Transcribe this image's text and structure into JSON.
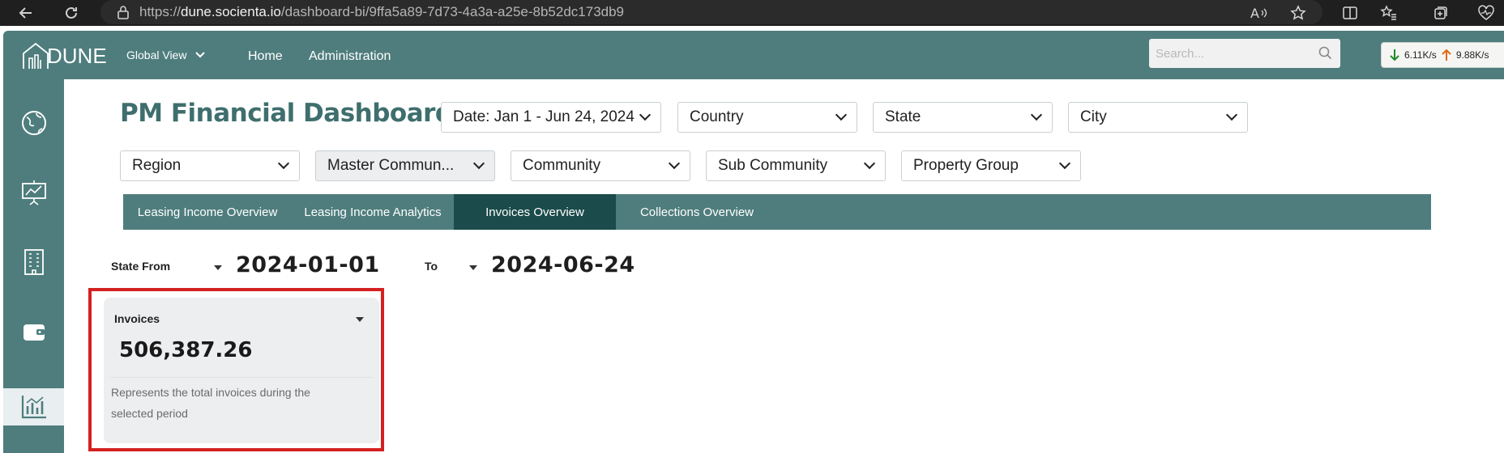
{
  "browser": {
    "url_prefix": "https://",
    "url_host": "dune.socienta.io",
    "url_path": "/dashboard-bi/9ffa5a89-7d73-4a3a-a25e-8b52dc173db9"
  },
  "header": {
    "logo_text": "DUNE",
    "global_view": "Global View",
    "nav": [
      "Home",
      "Administration"
    ],
    "search_placeholder": "Search...",
    "net_down": "6.11K/s",
    "net_up": "9.88K/s"
  },
  "sidebar": {
    "items": [
      "globe-icon",
      "presentation-chart-icon",
      "building-icon",
      "wallet-icon",
      "analytics-chart-icon"
    ],
    "active_index": 4
  },
  "dashboard": {
    "title": "PM Financial Dashboard",
    "filters_row1": [
      "Date: Jan 1 - Jun 24, 2024",
      "Country",
      "State",
      "City"
    ],
    "filters_row2": [
      "Region",
      "Master Commun...",
      "Community",
      "Sub Community",
      "Property Group"
    ],
    "tabs": [
      "Leasing Income Overview",
      "Leasing Income Analytics",
      "Invoices Overview",
      "Collections Overview"
    ],
    "active_tab": 2,
    "state_from_label": "State From",
    "state_from_value": "2024-01-01",
    "to_label": "To",
    "to_value": "2024-06-24"
  },
  "card": {
    "title": "Invoices",
    "value": "506,387.26",
    "description": "Represents the total invoices during the selected period"
  },
  "colors": {
    "brand_teal": "#4f7d7d",
    "active_tab": "#1b4b4b",
    "highlight": "#d42020"
  }
}
